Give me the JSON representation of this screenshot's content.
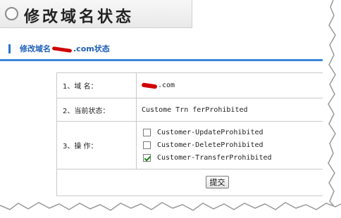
{
  "header": {
    "title": "修改域名状态"
  },
  "subheader": {
    "prefix": "修改域名",
    "suffix": ".com状态"
  },
  "form": {
    "rows": [
      {
        "label": "1、域  名：",
        "value_suffix": ".com"
      },
      {
        "label": "2、当前状态：",
        "value": "Custome Trn ferProhibited"
      },
      {
        "label": "3、操  作："
      }
    ],
    "options": [
      {
        "label": "Customer-UpdateProhibited",
        "checked": false
      },
      {
        "label": "Customer-DeleteProhibited",
        "checked": false
      },
      {
        "label": "Customer-TransferProhibited",
        "checked": true
      }
    ],
    "submit_label": "提交"
  },
  "colors": {
    "accent": "#3a87d8",
    "link_text": "#1d5fb8",
    "redaction": "#d00000"
  }
}
